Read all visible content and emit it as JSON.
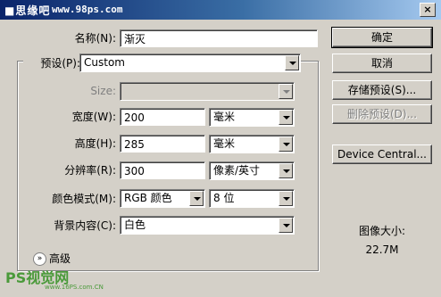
{
  "window": {
    "title_logo": "■思缘吧",
    "title_url": "www.98ps.com",
    "close_label": "×"
  },
  "form": {
    "name": {
      "label": "名称(N):",
      "value": "渐灭"
    },
    "preset": {
      "label": "预设(P):",
      "value": "Custom"
    },
    "size": {
      "label": "Size:",
      "value": ""
    },
    "width": {
      "label": "宽度(W):",
      "value": "200",
      "unit": "毫米"
    },
    "height": {
      "label": "高度(H):",
      "value": "285",
      "unit": "毫米"
    },
    "resolution": {
      "label": "分辨率(R):",
      "value": "300",
      "unit": "像素/英寸"
    },
    "color_mode": {
      "label": "颜色模式(M):",
      "value": "RGB 颜色",
      "depth": "8 位"
    },
    "background": {
      "label": "背景内容(C):",
      "value": "白色"
    },
    "advanced": {
      "label": "高级"
    }
  },
  "buttons": {
    "ok": "确定",
    "cancel": "取消",
    "save_preset": "存储预设(S)...",
    "delete_preset": "删除预设(D)...",
    "device_central": "Device Central..."
  },
  "image_size": {
    "label": "图像大小:",
    "value": "22.7M"
  },
  "watermark": {
    "text": "PS视觉网",
    "url": "www.16PS.com.CN"
  }
}
